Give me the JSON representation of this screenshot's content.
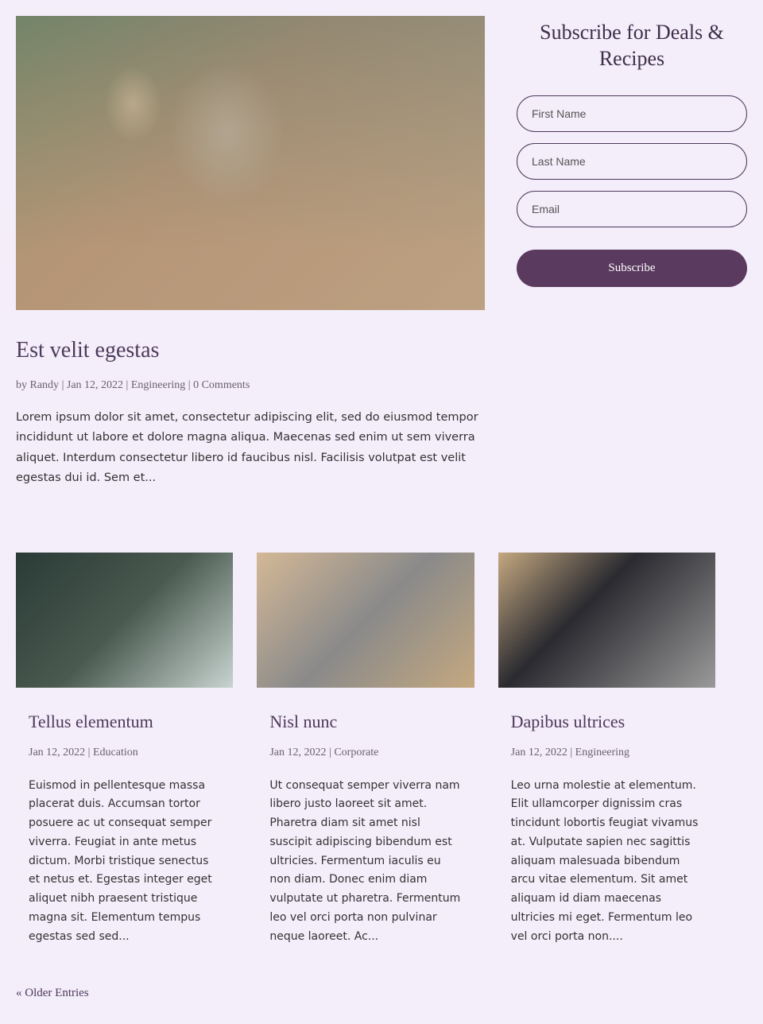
{
  "featured": {
    "title": "Est velit egestas",
    "by": "by ",
    "author": "Randy",
    "sep": " | ",
    "date": "Jan 12, 2022",
    "category": "Engineering",
    "comments": "0 Comments",
    "excerpt": "Lorem ipsum dolor sit amet, consectetur adipiscing elit, sed do eiusmod tempor incididunt ut labore et dolore magna aliqua. Maecenas sed enim ut sem viverra aliquet. Interdum consectetur libero id faucibus nisl. Facilisis volutpat est velit egestas dui id. Sem et..."
  },
  "cards": [
    {
      "title": "Tellus elementum",
      "date": "Jan 12, 2022",
      "sep": " | ",
      "category": "Education",
      "excerpt": "Euismod in pellentesque massa placerat duis. Accumsan tortor posuere ac ut consequat semper viverra. Feugiat in ante metus dictum. Morbi tristique senectus et netus et. Egestas integer eget aliquet nibh praesent tristique magna sit. Elementum tempus egestas sed sed..."
    },
    {
      "title": "Nisl nunc",
      "date": "Jan 12, 2022",
      "sep": " | ",
      "category": "Corporate",
      "excerpt": "Ut consequat semper viverra nam libero justo laoreet sit amet. Pharetra diam sit amet nisl suscipit adipiscing bibendum est ultricies. Fermentum iaculis eu non diam. Donec enim diam vulputate ut pharetra. Fermentum leo vel orci porta non pulvinar neque laoreet. Ac..."
    },
    {
      "title": "Dapibus ultrices",
      "date": "Jan 12, 2022",
      "sep": " | ",
      "category": "Engineering",
      "excerpt": "Leo urna molestie at elementum. Elit ullamcorper dignissim cras tincidunt lobortis feugiat vivamus at. Vulputate sapien nec sagittis aliquam malesuada bibendum arcu vitae elementum. Sit amet aliquam id diam maecenas ultricies mi eget. Fermentum leo vel orci porta non...."
    }
  ],
  "older": "« Older Entries",
  "sidebar": {
    "title": "Subscribe for Deals & Recipes",
    "first_name_placeholder": "First Name",
    "last_name_placeholder": "Last Name",
    "email_placeholder": "Email",
    "button": "Subscribe"
  }
}
